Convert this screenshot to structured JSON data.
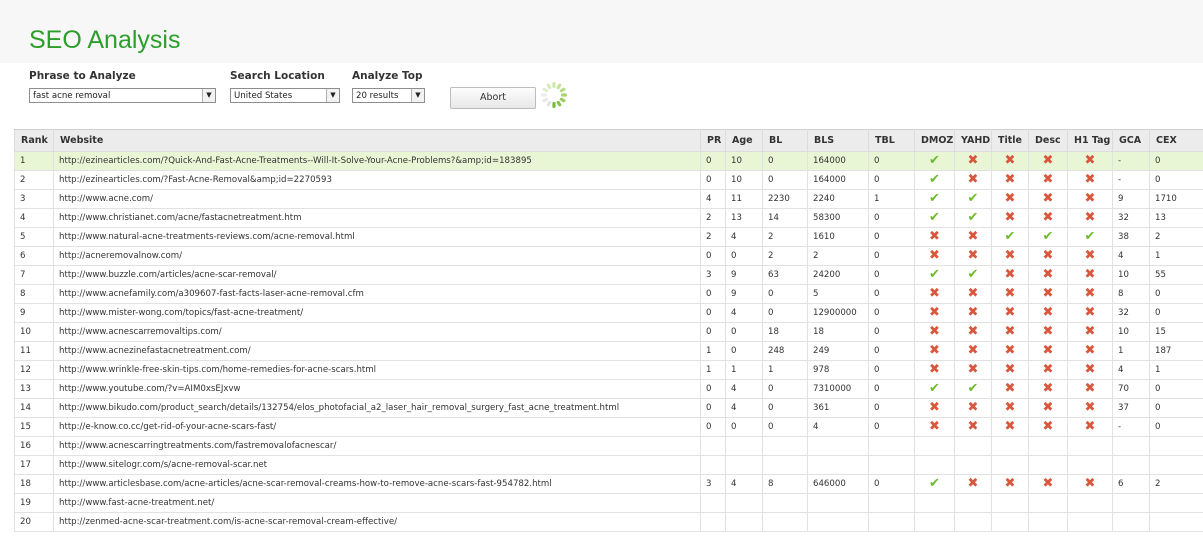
{
  "app_title": "SEO Analysis",
  "controls": {
    "phrase_label": "Phrase to Analyze",
    "phrase_value": "fast acne removal",
    "location_label": "Search Location",
    "location_value": "United States",
    "top_label": "Analyze Top",
    "top_value": "20 results",
    "abort_label": "Abort"
  },
  "colors": {
    "title": "#2c9e2c",
    "check": "#6dbb2b",
    "cross": "#d9573c",
    "selected_row": "#e9f6d5"
  },
  "icons": {
    "check": "check-icon",
    "cross": "cross-icon",
    "loading": "loading-spinner-icon",
    "dropdown": "chevron-down-icon"
  },
  "table": {
    "columns": [
      "Rank",
      "Website",
      "PR",
      "Age",
      "BL",
      "BLS",
      "TBL",
      "DMOZ",
      "YAHD",
      "Title",
      "Desc",
      "H1 Tag",
      "GCA",
      "CEX"
    ],
    "rows": [
      {
        "rank": "1",
        "url": "http://ezinearticles.com/?Quick-And-Fast-Acne-Treatments--Will-It-Solve-Your-Acne-Problems?&amp;id=183895",
        "pr": "0",
        "age": "10",
        "bl": "0",
        "bls": "164000",
        "tbl": "0",
        "dmoz": "check",
        "yahd": "cross",
        "title": "cross",
        "desc": "cross",
        "h1": "cross",
        "gca": "-",
        "cex": "0"
      },
      {
        "rank": "2",
        "url": "http://ezinearticles.com/?Fast-Acne-Removal&amp;id=2270593",
        "pr": "0",
        "age": "10",
        "bl": "0",
        "bls": "164000",
        "tbl": "0",
        "dmoz": "check",
        "yahd": "cross",
        "title": "cross",
        "desc": "cross",
        "h1": "cross",
        "gca": "-",
        "cex": "0"
      },
      {
        "rank": "3",
        "url": "http://www.acne.com/",
        "pr": "4",
        "age": "11",
        "bl": "2230",
        "bls": "2240",
        "tbl": "1",
        "dmoz": "check",
        "yahd": "check",
        "title": "cross",
        "desc": "cross",
        "h1": "cross",
        "gca": "9",
        "cex": "1710"
      },
      {
        "rank": "4",
        "url": "http://www.christianet.com/acne/fastacnetreatment.htm",
        "pr": "2",
        "age": "13",
        "bl": "14",
        "bls": "58300",
        "tbl": "0",
        "dmoz": "check",
        "yahd": "check",
        "title": "cross",
        "desc": "cross",
        "h1": "cross",
        "gca": "32",
        "cex": "13"
      },
      {
        "rank": "5",
        "url": "http://www.natural-acne-treatments-reviews.com/acne-removal.html",
        "pr": "2",
        "age": "4",
        "bl": "2",
        "bls": "1610",
        "tbl": "0",
        "dmoz": "cross",
        "yahd": "cross",
        "title": "check",
        "desc": "check",
        "h1": "check",
        "gca": "38",
        "cex": "2"
      },
      {
        "rank": "6",
        "url": "http://acneremovalnow.com/",
        "pr": "0",
        "age": "0",
        "bl": "2",
        "bls": "2",
        "tbl": "0",
        "dmoz": "cross",
        "yahd": "cross",
        "title": "cross",
        "desc": "cross",
        "h1": "cross",
        "gca": "4",
        "cex": "1"
      },
      {
        "rank": "7",
        "url": "http://www.buzzle.com/articles/acne-scar-removal/",
        "pr": "3",
        "age": "9",
        "bl": "63",
        "bls": "24200",
        "tbl": "0",
        "dmoz": "check",
        "yahd": "check",
        "title": "cross",
        "desc": "cross",
        "h1": "cross",
        "gca": "10",
        "cex": "55"
      },
      {
        "rank": "8",
        "url": "http://www.acnefamily.com/a309607-fast-facts-laser-acne-removal.cfm",
        "pr": "0",
        "age": "9",
        "bl": "0",
        "bls": "5",
        "tbl": "0",
        "dmoz": "cross",
        "yahd": "cross",
        "title": "cross",
        "desc": "cross",
        "h1": "cross",
        "gca": "8",
        "cex": "0"
      },
      {
        "rank": "9",
        "url": "http://www.mister-wong.com/topics/fast-acne-treatment/",
        "pr": "0",
        "age": "4",
        "bl": "0",
        "bls": "12900000",
        "tbl": "0",
        "dmoz": "cross",
        "yahd": "cross",
        "title": "cross",
        "desc": "cross",
        "h1": "cross",
        "gca": "32",
        "cex": "0"
      },
      {
        "rank": "10",
        "url": "http://www.acnescarremovaltips.com/",
        "pr": "0",
        "age": "0",
        "bl": "18",
        "bls": "18",
        "tbl": "0",
        "dmoz": "cross",
        "yahd": "cross",
        "title": "cross",
        "desc": "cross",
        "h1": "cross",
        "gca": "10",
        "cex": "15"
      },
      {
        "rank": "11",
        "url": "http://www.acnezinefastacnetreatment.com/",
        "pr": "1",
        "age": "0",
        "bl": "248",
        "bls": "249",
        "tbl": "0",
        "dmoz": "cross",
        "yahd": "cross",
        "title": "cross",
        "desc": "cross",
        "h1": "cross",
        "gca": "1",
        "cex": "187"
      },
      {
        "rank": "12",
        "url": "http://www.wrinkle-free-skin-tips.com/home-remedies-for-acne-scars.html",
        "pr": "1",
        "age": "1",
        "bl": "1",
        "bls": "978",
        "tbl": "0",
        "dmoz": "cross",
        "yahd": "cross",
        "title": "cross",
        "desc": "cross",
        "h1": "cross",
        "gca": "4",
        "cex": "1"
      },
      {
        "rank": "13",
        "url": "http://www.youtube.com/?v=AIM0xsEJxvw",
        "pr": "0",
        "age": "4",
        "bl": "0",
        "bls": "7310000",
        "tbl": "0",
        "dmoz": "check",
        "yahd": "check",
        "title": "cross",
        "desc": "cross",
        "h1": "cross",
        "gca": "70",
        "cex": "0"
      },
      {
        "rank": "14",
        "url": "http://www.bikudo.com/product_search/details/132754/elos_photofacial_a2_laser_hair_removal_surgery_fast_acne_treatment.html",
        "pr": "0",
        "age": "4",
        "bl": "0",
        "bls": "361",
        "tbl": "0",
        "dmoz": "cross",
        "yahd": "cross",
        "title": "cross",
        "desc": "cross",
        "h1": "cross",
        "gca": "37",
        "cex": "0"
      },
      {
        "rank": "15",
        "url": "http://e-know.co.cc/get-rid-of-your-acne-scars-fast/",
        "pr": "0",
        "age": "0",
        "bl": "0",
        "bls": "4",
        "tbl": "0",
        "dmoz": "cross",
        "yahd": "cross",
        "title": "cross",
        "desc": "cross",
        "h1": "cross",
        "gca": "-",
        "cex": "0"
      },
      {
        "rank": "16",
        "url": "http://www.acnescarringtreatments.com/fastremovalofacnescar/",
        "pr": "",
        "age": "",
        "bl": "",
        "bls": "",
        "tbl": "",
        "dmoz": "",
        "yahd": "",
        "title": "",
        "desc": "",
        "h1": "",
        "gca": "",
        "cex": ""
      },
      {
        "rank": "17",
        "url": "http://www.sitelogr.com/s/acne-removal-scar.net",
        "pr": "",
        "age": "",
        "bl": "",
        "bls": "",
        "tbl": "",
        "dmoz": "",
        "yahd": "",
        "title": "",
        "desc": "",
        "h1": "",
        "gca": "",
        "cex": ""
      },
      {
        "rank": "18",
        "url": "http://www.articlesbase.com/acne-articles/acne-scar-removal-creams-how-to-remove-acne-scars-fast-954782.html",
        "pr": "3",
        "age": "4",
        "bl": "8",
        "bls": "646000",
        "tbl": "0",
        "dmoz": "check",
        "yahd": "cross",
        "title": "cross",
        "desc": "cross",
        "h1": "cross",
        "gca": "6",
        "cex": "2"
      },
      {
        "rank": "19",
        "url": "http://www.fast-acne-treatment.net/",
        "pr": "",
        "age": "",
        "bl": "",
        "bls": "",
        "tbl": "",
        "dmoz": "",
        "yahd": "",
        "title": "",
        "desc": "",
        "h1": "",
        "gca": "",
        "cex": ""
      },
      {
        "rank": "20",
        "url": "http://zenmed-acne-scar-treatment.com/is-acne-scar-removal-cream-effective/",
        "pr": "",
        "age": "",
        "bl": "",
        "bls": "",
        "tbl": "",
        "dmoz": "",
        "yahd": "",
        "title": "",
        "desc": "",
        "h1": "",
        "gca": "",
        "cex": ""
      }
    ]
  }
}
